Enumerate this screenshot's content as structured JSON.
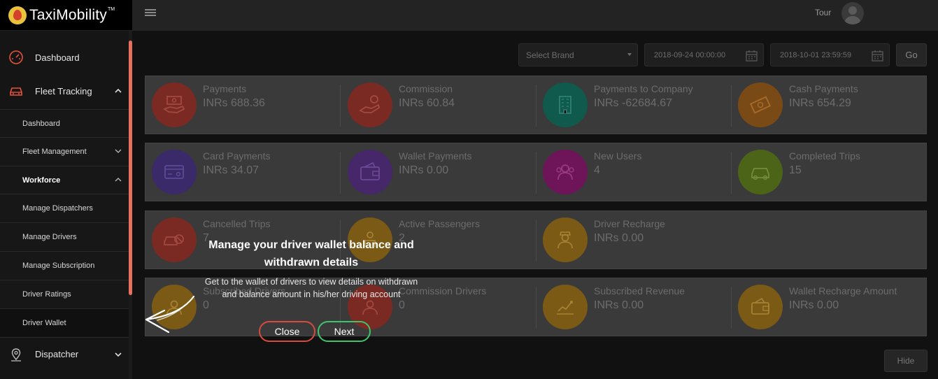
{
  "app": {
    "brand": "TaxiMobility",
    "trademark": "TM"
  },
  "sidebar": {
    "main_items": [
      {
        "label": "Dashboard",
        "icon": "speedometer-icon"
      },
      {
        "label": "Fleet Tracking",
        "icon": "car-icon"
      },
      {
        "label": "Dispatcher",
        "icon": "map-pin-icon"
      }
    ],
    "sub_items": [
      {
        "label": "Dashboard"
      },
      {
        "label": "Fleet Management"
      },
      {
        "label": "Workforce"
      },
      {
        "label": "Manage Dispatchers"
      },
      {
        "label": "Manage Drivers"
      },
      {
        "label": "Manage Subscription"
      },
      {
        "label": "Driver Ratings"
      },
      {
        "label": "Driver Wallet"
      }
    ],
    "active_item": "Driver Wallet"
  },
  "header": {
    "tour_label": "Tour"
  },
  "filters": {
    "brand_placeholder": "Select Brand",
    "date_from": "2018-09-24 00:00:00",
    "date_to": "2018-10-01 23:59:59",
    "go_label": "Go"
  },
  "stats": [
    {
      "label": "Payments",
      "value": "INRs 688.36",
      "color": "#c0392b",
      "icon": "payment-hand-icon"
    },
    {
      "label": "Commission",
      "value": "INRs 60.84",
      "color": "#c0392b",
      "icon": "commission-hand-icon"
    },
    {
      "label": "Payments to Company",
      "value": "INRs -62684.67",
      "color": "#16a085",
      "icon": "building-icon"
    },
    {
      "label": "Cash Payments",
      "value": "INRs 654.29",
      "color": "#e67e22",
      "icon": "cash-icon"
    },
    {
      "label": "Card Payments",
      "value": "INRs 34.07",
      "color": "#5b3fa8",
      "icon": "credit-card-icon"
    },
    {
      "label": "Wallet Payments",
      "value": "INRs 0.00",
      "color": "#6f3fa8",
      "icon": "wallet-icon"
    },
    {
      "label": "New Users",
      "value": "4",
      "color": "#c2189c",
      "icon": "users-icon"
    },
    {
      "label": "Completed Trips",
      "value": "15",
      "color": "#8bb52a",
      "icon": "car-outline-icon"
    },
    {
      "label": "Cancelled Trips",
      "value": "7",
      "color": "#c0392b",
      "icon": "car-cancel-icon"
    },
    {
      "label": "Active Passengers",
      "value": "2",
      "color": "#e6a817",
      "icon": "passenger-icon"
    },
    {
      "label": "Driver Recharge",
      "value": "INRs 0.00",
      "color": "#e6a817",
      "icon": "driver-icon"
    },
    {
      "label": "Subscribed Drivers",
      "value": "0",
      "color": "#e6a817",
      "icon": "subscribed-driver-icon"
    },
    {
      "label": "Commission Drivers",
      "value": "0",
      "color": "#c0392b",
      "icon": "commission-driver-icon"
    },
    {
      "label": "Subscribed Revenue",
      "value": "INRs 0.00",
      "color": "#e6a817",
      "icon": "revenue-chart-icon"
    },
    {
      "label": "Wallet Recharge Amount",
      "value": "INRs 0.00",
      "color": "#e6a817",
      "icon": "wallet-recharge-icon"
    }
  ],
  "hide_label": "Hide",
  "tour_tip": {
    "title": "Manage your driver wallet balance and withdrawn details",
    "description": "Get to the wallet of drivers to view details on withdrawn and balance amount in his/her driving account",
    "close_label": "Close",
    "next_label": "Next"
  }
}
